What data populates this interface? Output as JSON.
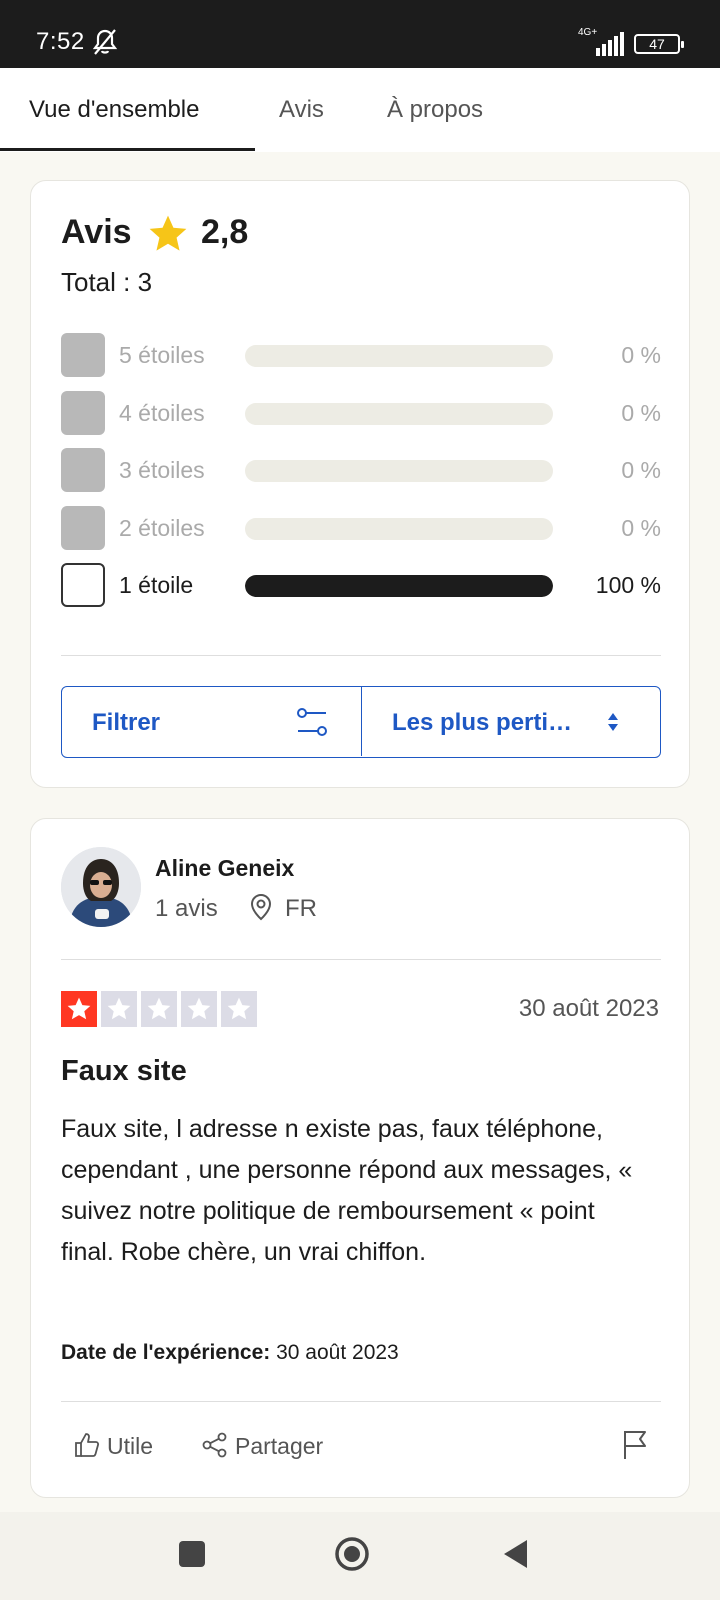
{
  "status_bar": {
    "time": "7:52",
    "network": "4G+",
    "battery": "47"
  },
  "tabs": [
    {
      "label": "Vue d'ensemble",
      "active": true
    },
    {
      "label": "Avis",
      "active": false
    },
    {
      "label": "À propos",
      "active": false
    }
  ],
  "summary": {
    "title": "Avis",
    "score": "2,8",
    "total": "Total : 3",
    "rows": [
      {
        "label": "5 étoiles",
        "percent_text": "0 %",
        "fraction": 0
      },
      {
        "label": "4 étoiles",
        "percent_text": "0 %",
        "fraction": 0
      },
      {
        "label": "3 étoiles",
        "percent_text": "0 %",
        "fraction": 0
      },
      {
        "label": "2 étoiles",
        "percent_text": "0 %",
        "fraction": 0
      },
      {
        "label": "1 étoile",
        "percent_text": "100 %",
        "fraction": 1
      }
    ],
    "filter_label": "Filtrer",
    "sort_label": "Les plus perti…"
  },
  "review": {
    "author": "Aline Geneix",
    "reviews_count": "1 avis",
    "country": "FR",
    "rating": 1,
    "date": "30 août 2023",
    "title": "Faux site",
    "body": "Faux site, l adresse n existe pas, faux téléphone, cependant , une personne répond aux messages, « suivez notre politique de remboursement «  point final. Robe chère, un vrai chiffon.",
    "experience_label": "Date de l'expérience:",
    "experience_date": "30 août 2023",
    "useful_label": "Utile",
    "share_label": "Partager"
  },
  "colors": {
    "accent": "#1e58c4",
    "star_red": "#ff3722",
    "star_gold": "#f6c518"
  }
}
